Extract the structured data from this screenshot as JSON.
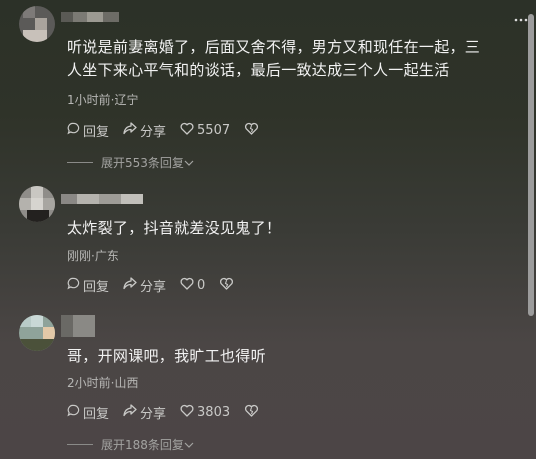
{
  "comments": [
    {
      "text_line1": "听说是前妻离婚了，后面又舍不得，男方又和现任在一起，三",
      "text_line2": "人坐下来心平气和的谈话，最后一致达成三个人一起生活",
      "meta": "1小时前·辽宁",
      "reply_label": "回复",
      "share_label": "分享",
      "likes": "5507",
      "expand_replies": "展开553条回复"
    },
    {
      "text_line1": "太炸裂了，抖音就差没见鬼了！",
      "meta": "刚刚·广东",
      "reply_label": "回复",
      "share_label": "分享",
      "likes": "0"
    },
    {
      "text_line1": "哥，开网课吧，我旷工也得听",
      "meta": "2小时前·山西",
      "reply_label": "回复",
      "share_label": "分享",
      "likes": "3803",
      "expand_replies": "展开188条回复"
    }
  ],
  "colors": {
    "text": "#f2f2f2",
    "meta": "#b7b7b5",
    "action": "#c9c9c7"
  },
  "icons": [
    "reply-icon",
    "share-icon",
    "like-icon",
    "dislike-icon",
    "chevron-down-icon",
    "more-icon"
  ]
}
